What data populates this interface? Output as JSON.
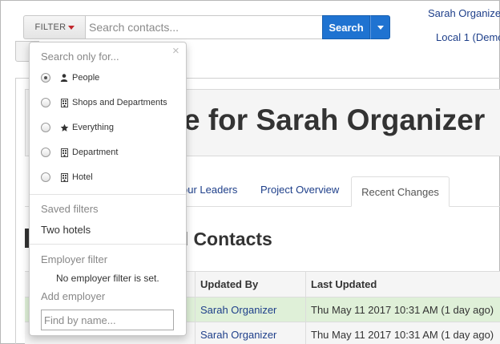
{
  "header": {
    "filter_label": "FILTER",
    "search_placeholder": "Search contacts...",
    "search_button": "Search",
    "user_name": "Sarah Organize",
    "org_name": "Local 1 (Demo"
  },
  "page": {
    "title": "e for Sarah Organizer",
    "tabs": [
      "our Leaders",
      "Project Overview"
    ],
    "active_tab": "Recent Changes",
    "section_title": "d Contacts"
  },
  "table": {
    "headers": [
      "Updated By",
      "Last Updated"
    ],
    "rows": [
      {
        "updated_by": "Sarah Organizer",
        "last_updated": "Thu May 11 2017 10:31 AM (1 day ago)",
        "highlight": true
      },
      {
        "updated_by": "Sarah Organizer",
        "last_updated": "Thu May 11 2017 10:31 AM (1 day ago)",
        "highlight": false
      }
    ]
  },
  "dropdown": {
    "close_glyph": "×",
    "header": "Search only for...",
    "options": [
      {
        "label": "People",
        "icon": "person-icon",
        "checked": true
      },
      {
        "label": "Shops and Departments",
        "icon": "building-icon",
        "checked": false
      },
      {
        "label": "Everything",
        "icon": "star-icon",
        "checked": false
      },
      {
        "label": "Department",
        "icon": "building-icon",
        "checked": false
      },
      {
        "label": "Hotel",
        "icon": "building-icon",
        "checked": false
      }
    ],
    "saved_filters_label": "Saved filters",
    "saved_filters": [
      "Two hotels"
    ],
    "employer_filter_label": "Employer filter",
    "employer_filter_note": "No employer filter is set.",
    "add_employer_label": "Add employer",
    "employer_placeholder": "Find by name...",
    "accent": "#1f73d1"
  }
}
